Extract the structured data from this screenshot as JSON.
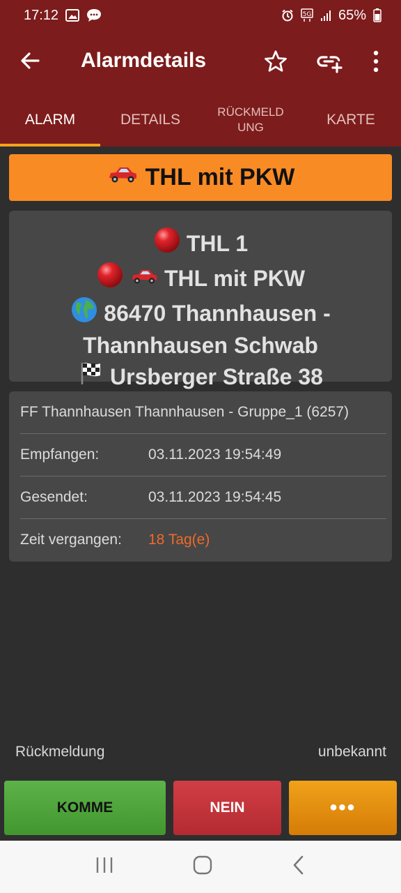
{
  "status": {
    "time": "17:12",
    "battery": "65%"
  },
  "appbar": {
    "title": "Alarmdetails"
  },
  "tabs": [
    {
      "label": "ALARM"
    },
    {
      "label": "DETAILS"
    },
    {
      "label": "RÜCKMELD\nUNG"
    },
    {
      "label": "KARTE"
    }
  ],
  "banner": {
    "text": "THL mit PKW"
  },
  "summary": {
    "line1": "THL 1",
    "line2": "THL mit PKW",
    "line3": "86470 Thannhausen -",
    "line4": "Thannhausen Schwab",
    "line5": "Ursberger Straße 38"
  },
  "info": {
    "unit": "FF Thannhausen Thannhausen - Gruppe_1 (6257)",
    "received_label": "Empfangen:",
    "received_value": "03.11.2023 19:54:49",
    "sent_label": "Gesendet:",
    "sent_value": "03.11.2023 19:54:45",
    "elapsed_label": "Zeit vergangen:",
    "elapsed_value": "18 Tag(e)"
  },
  "response": {
    "label": "Rückmeldung",
    "value": "unbekannt"
  },
  "buttons": {
    "komme": "KOMME",
    "nein": "NEIN",
    "more": "•••"
  },
  "colors": {
    "accent": "#7d1c1c",
    "banner": "#f98b25",
    "komme": "#4fa83b",
    "nein": "#c3343b",
    "more": "#e68e0f"
  }
}
